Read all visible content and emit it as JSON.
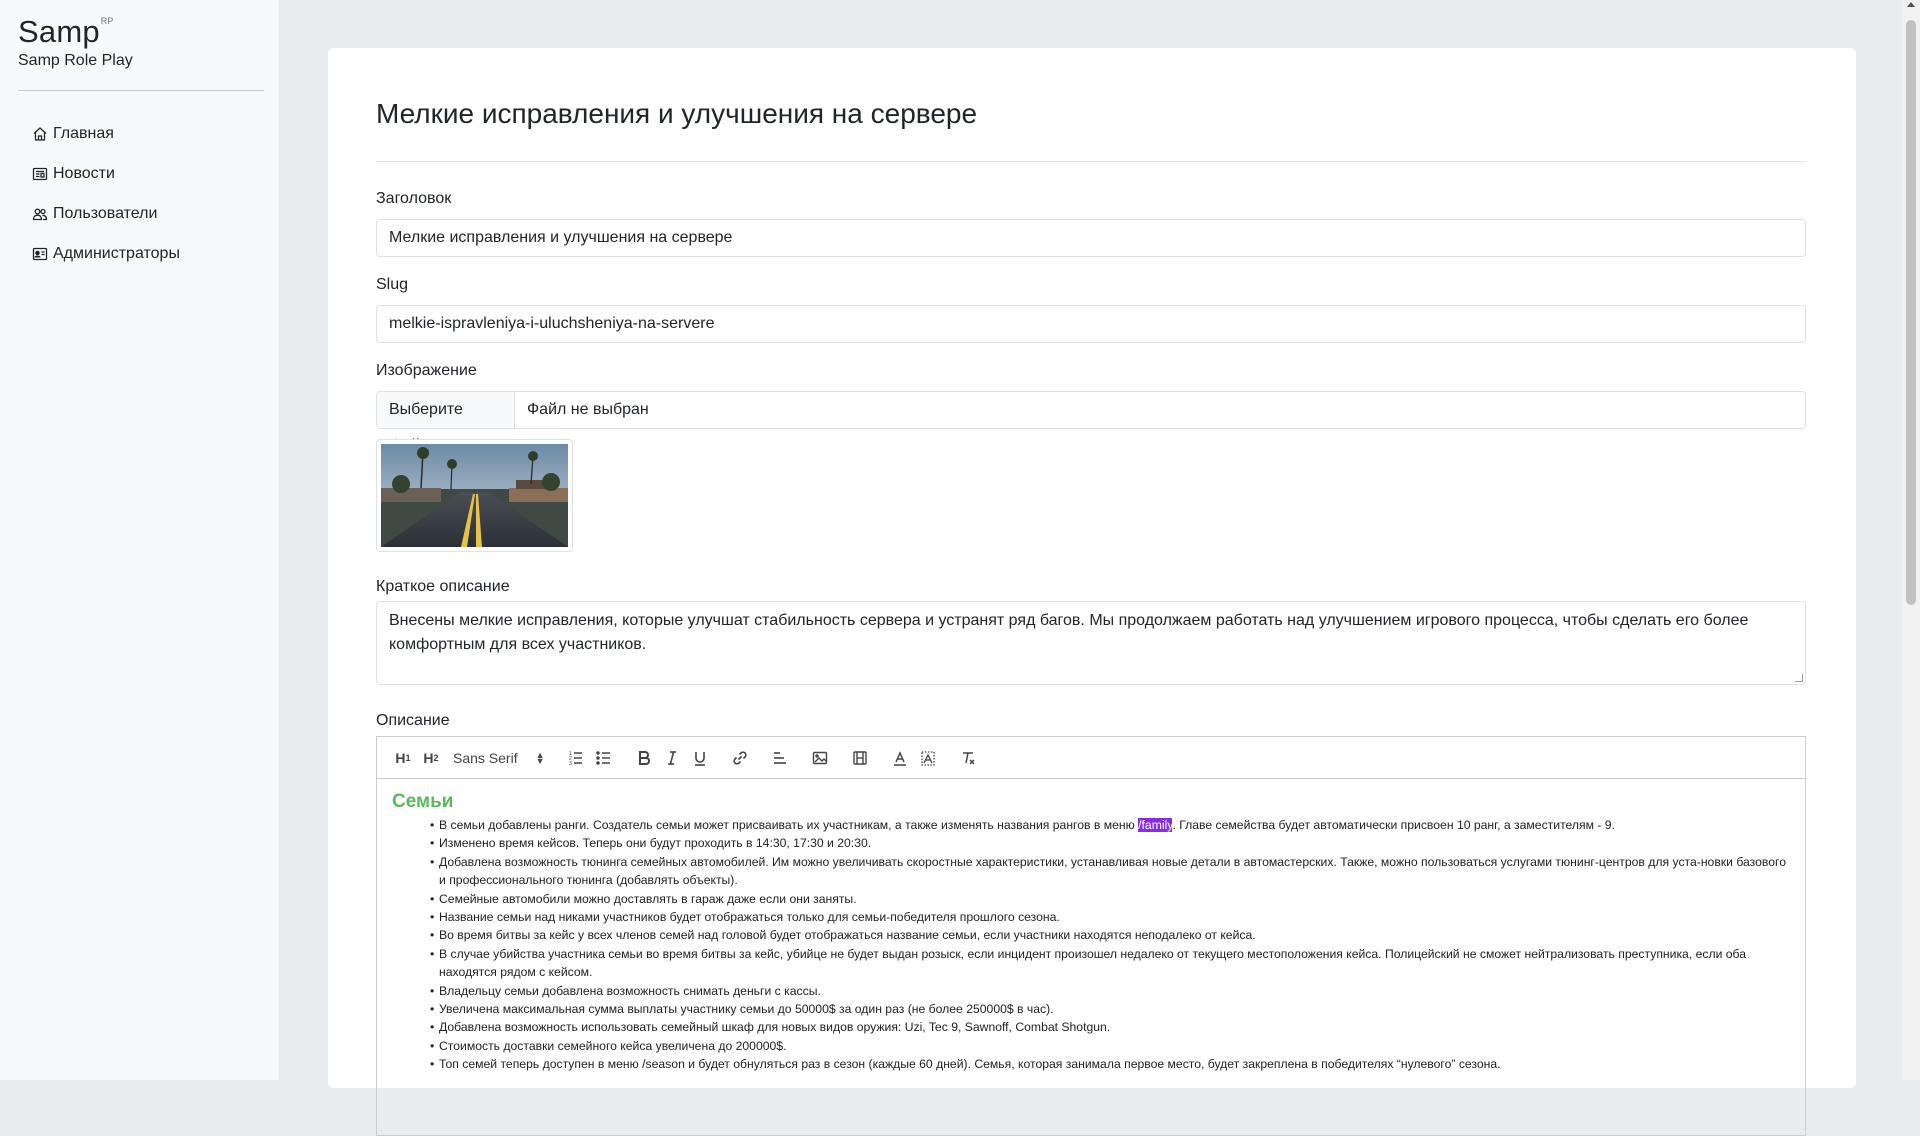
{
  "sidebar": {
    "brand": "Samp",
    "brand_sup": "RP",
    "brand_sub": "Samp Role Play",
    "items": [
      {
        "label": "Главная",
        "icon": "home-icon"
      },
      {
        "label": "Новости",
        "icon": "newspaper-icon"
      },
      {
        "label": "Пользователи",
        "icon": "users-icon"
      },
      {
        "label": "Администраторы",
        "icon": "person-badge-icon"
      }
    ]
  },
  "page": {
    "title": "Мелкие исправления и улучшения на сервере"
  },
  "form": {
    "title_label": "Заголовок",
    "title_value": "Мелкие исправления и улучшения на сервере",
    "slug_label": "Slug",
    "slug_value": "melkie-ispravleniya-i-uluchsheniya-na-servere",
    "image_label": "Изображение",
    "file_button": "Выберите файл",
    "file_status": "Файл не выбран",
    "short_label": "Краткое описание",
    "short_value": "Внесены мелкие исправления, которые улучшат стабильность сервера и устранят ряд багов. Мы продолжаем работать над улучшением игрового процесса, чтобы сделать его более комфортным для всех участников.",
    "desc_label": "Описание"
  },
  "editor": {
    "toolbar": {
      "h1": "H",
      "h1_sub": "1",
      "h2": "H",
      "h2_sub": "2",
      "font": "Sans Serif"
    },
    "heading": "Семьи",
    "items": [
      {
        "before": "В семьи добавлены ранги. Создатель семьи может присваивать их участникам, а также изменять названия рангов в меню ",
        "highlight": "/family",
        "after": ". Главе семейства будет автоматически присвоен 10 ранг, а заместителям - 9."
      },
      {
        "before": "Изменено время кейсов. Теперь они будут проходить в 14:30, 17:30 и 20:30.",
        "highlight": "",
        "after": ""
      },
      {
        "before": "Добавлена возможность тюнинга семейных автомобилей. Им можно увеличивать скоростные характеристики, устанавливая новые детали в автомастерских. Также, можно пользоваться услугами тюнинг-центров для уста-новки базового и профессионального тюнинга (добавлять объекты).",
        "highlight": "",
        "after": ""
      },
      {
        "before": "Семейные автомобили можно доставлять в гараж даже если они заняты.",
        "highlight": "",
        "after": ""
      },
      {
        "before": "Название семьи над никами участников будет отображаться только для семьи-победителя прошлого сезона.",
        "highlight": "",
        "after": ""
      },
      {
        "before": "Во время битвы за кейс у всех членов семей над головой будет отображаться название семьи, если участники находятся неподалеко от кейса.",
        "highlight": "",
        "after": ""
      },
      {
        "before": "В случае убийства участника семьи во время битвы за кейс, убийце не будет выдан розыск, если инцидент произошел недалеко от текущего местоположения кейса. Полицейский не сможет нейтрализовать преступника, если оба находятся рядом с кейсом.",
        "highlight": "",
        "after": ""
      },
      {
        "before": "Владельцу семьи добавлена возможность снимать деньги с кассы.",
        "highlight": "",
        "after": ""
      },
      {
        "before": "Увеличена максимальная сумма выплаты участнику семьи до 50000$ за один раз (не более 250000$ в час).",
        "highlight": "",
        "after": ""
      },
      {
        "before": "Добавлена возможность использовать семейный шкаф для новых видов оружия: Uzi, Tec 9, Sawnoff, Combat Shotgun.",
        "highlight": "",
        "after": ""
      },
      {
        "before": "Стоимость доставки семейного кейса увеличена до 200000$.",
        "highlight": "",
        "after": ""
      },
      {
        "before": "Топ семей теперь доступен в меню /season и будет обнуляться раз в сезон (каждые 60 дней). Семья, которая занимала первое место, будет закреплена в победителях “нулевого” сезона.",
        "highlight": "",
        "after": ""
      }
    ]
  },
  "colors": {
    "heading_green": "#5cb85c",
    "highlight": "#8a2be2"
  }
}
